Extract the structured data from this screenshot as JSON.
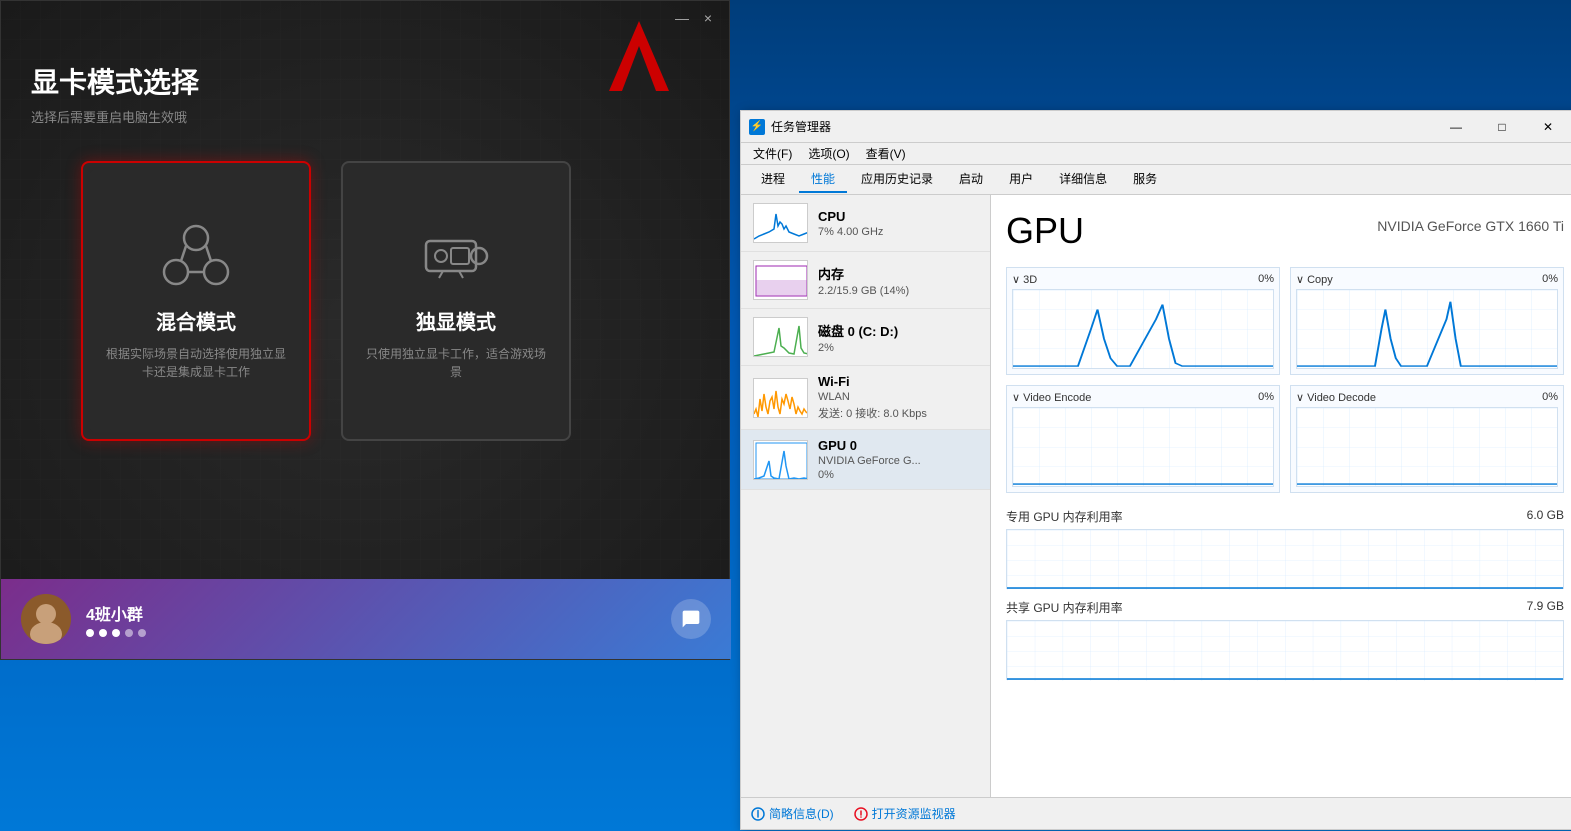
{
  "desktop": {
    "bg_color": "#0058b3"
  },
  "gpu_selector": {
    "title": "显卡模式选择",
    "subtitle": "选择后需要重启电脑生效哦",
    "minimize_btn": "—",
    "close_btn": "×",
    "cards": [
      {
        "id": "mixed",
        "title": "混合模式",
        "desc": "根据实际场景自动选择使用独立显卡还是集成显卡工作",
        "selected": true
      },
      {
        "id": "discrete",
        "title": "独显模式",
        "desc": "只使用独立显卡工作，适合游戏场景",
        "selected": false
      }
    ],
    "bottom_bar": {
      "group_name": "4班小群",
      "dots": [
        true,
        true,
        true,
        false,
        false
      ]
    }
  },
  "taskmgr": {
    "title": "任务管理器",
    "window_btns": [
      "—",
      "□",
      "×"
    ],
    "menu": [
      "文件(F)",
      "选项(O)",
      "查看(V)"
    ],
    "tabs": [
      "进程",
      "性能",
      "应用历史记录",
      "启动",
      "用户",
      "详细信息",
      "服务"
    ],
    "active_tab": "性能",
    "sidebar": {
      "items": [
        {
          "name": "CPU",
          "detail": "7%  4.00 GHz",
          "color": "#0078d7"
        },
        {
          "name": "内存",
          "detail": "2.2/15.9 GB (14%)",
          "color": "#9c27b0"
        },
        {
          "name": "磁盘 0 (C: D:)",
          "detail": "2%",
          "color": "#4caf50"
        },
        {
          "name": "Wi-Fi",
          "detail": "WLAN",
          "detail2": "发送: 0  接收: 8.0 Kbps",
          "color": "#ff9800"
        },
        {
          "name": "GPU 0",
          "detail": "NVIDIA GeForce G...",
          "detail2": "0%",
          "color": "#2196f3",
          "active": true
        }
      ]
    },
    "content": {
      "gpu_title": "GPU",
      "gpu_model": "NVIDIA GeForce GTX 1660 Ti",
      "charts": [
        {
          "label": "3D",
          "value": "0%",
          "prefix": "∨ "
        },
        {
          "label": "Copy",
          "value": "0%",
          "prefix": "∨ "
        },
        {
          "label": "Video Encode",
          "value": "0%",
          "prefix": "∨ "
        },
        {
          "label": "Video Decode",
          "value": "0%",
          "prefix": "∨ "
        }
      ],
      "memory_sections": [
        {
          "label": "专用 GPU 内存利用率",
          "value": "6.0 GB"
        },
        {
          "label": "共享 GPU 内存利用率",
          "value": "7.9 GB"
        }
      ]
    },
    "statusbar": {
      "summary_label": "简略信息(D)",
      "resource_label": "打开资源监视器"
    }
  }
}
